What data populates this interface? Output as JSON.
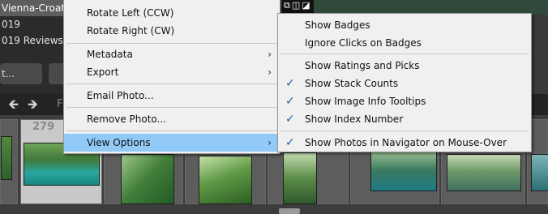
{
  "collections": {
    "items": [
      {
        "label": "Vienna-Croat",
        "selected": true
      },
      {
        "label": "019",
        "selected": false
      },
      {
        "label": "019 Reviews",
        "selected": false
      }
    ]
  },
  "buttons": {
    "left_label": "t...",
    "right_label": ""
  },
  "filmstrip": {
    "active_index_label": "279",
    "nav_label": "F"
  },
  "top_icons": "⧉◫◪",
  "context_menu": {
    "items": [
      {
        "label": "Rotate Left (CCW)",
        "has_submenu": false
      },
      {
        "label": "Rotate Right (CW)",
        "has_submenu": false
      },
      {
        "label": "Metadata",
        "has_submenu": true
      },
      {
        "label": "Export",
        "has_submenu": true
      },
      {
        "label": "Email Photo...",
        "has_submenu": false
      },
      {
        "label": "Remove Photo...",
        "has_submenu": false
      },
      {
        "label": "View Options",
        "has_submenu": true,
        "highlighted": true
      }
    ],
    "arrow_glyph": "›"
  },
  "view_options_menu": {
    "check_glyph": "✓",
    "items": [
      {
        "label": "Show Badges",
        "checked": false
      },
      {
        "label": "Ignore Clicks on Badges",
        "checked": false
      },
      {
        "label": "Show Ratings and Picks",
        "checked": false
      },
      {
        "label": "Show Stack Counts",
        "checked": true
      },
      {
        "label": "Show Image Info Tooltips",
        "checked": true
      },
      {
        "label": "Show Index Number",
        "checked": true
      },
      {
        "label": "Show Photos in Navigator on Mouse-Over",
        "checked": true
      }
    ]
  },
  "colors": {
    "menu_bg": "#f0f0f0",
    "highlight": "#91c9f7",
    "check": "#1f5fa8",
    "panel_dark": "#2b2b2b"
  }
}
